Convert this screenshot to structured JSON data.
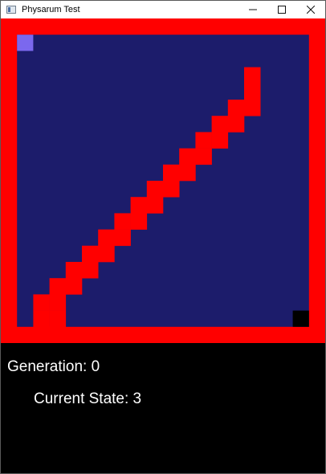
{
  "window": {
    "title": "Physarum Test",
    "controls": [
      {
        "name": "minimize",
        "icon": "minimize-icon"
      },
      {
        "name": "maximize",
        "icon": "maximize-icon"
      },
      {
        "name": "close",
        "icon": "close-icon"
      }
    ]
  },
  "colors": {
    "border": "#ff0000",
    "field": "#1c1c6b",
    "path": "#ff0000",
    "source": "#7b68ee",
    "target": "#000000",
    "background": "#000000",
    "text": "#ffffff"
  },
  "grid": {
    "columns": 20,
    "rows": 20,
    "source_cell": {
      "col": 1,
      "row": 1
    },
    "target_cell": {
      "col": 18,
      "row": 18
    },
    "path_cells": [
      [
        15,
        3
      ],
      [
        15,
        4
      ],
      [
        15,
        5
      ],
      [
        14,
        5
      ],
      [
        14,
        6
      ],
      [
        13,
        6
      ],
      [
        13,
        7
      ],
      [
        12,
        7
      ],
      [
        12,
        8
      ],
      [
        11,
        8
      ],
      [
        11,
        9
      ],
      [
        10,
        9
      ],
      [
        10,
        10
      ],
      [
        9,
        10
      ],
      [
        9,
        11
      ],
      [
        8,
        11
      ],
      [
        8,
        12
      ],
      [
        7,
        12
      ],
      [
        7,
        13
      ],
      [
        6,
        13
      ],
      [
        6,
        14
      ],
      [
        5,
        14
      ],
      [
        5,
        15
      ],
      [
        4,
        15
      ],
      [
        4,
        16
      ],
      [
        3,
        16
      ],
      [
        3,
        17
      ],
      [
        2,
        17
      ],
      [
        2,
        18
      ],
      [
        3,
        18
      ]
    ]
  },
  "status": {
    "generation_label": "Generation: 0",
    "state_label": "Current State: 3"
  }
}
